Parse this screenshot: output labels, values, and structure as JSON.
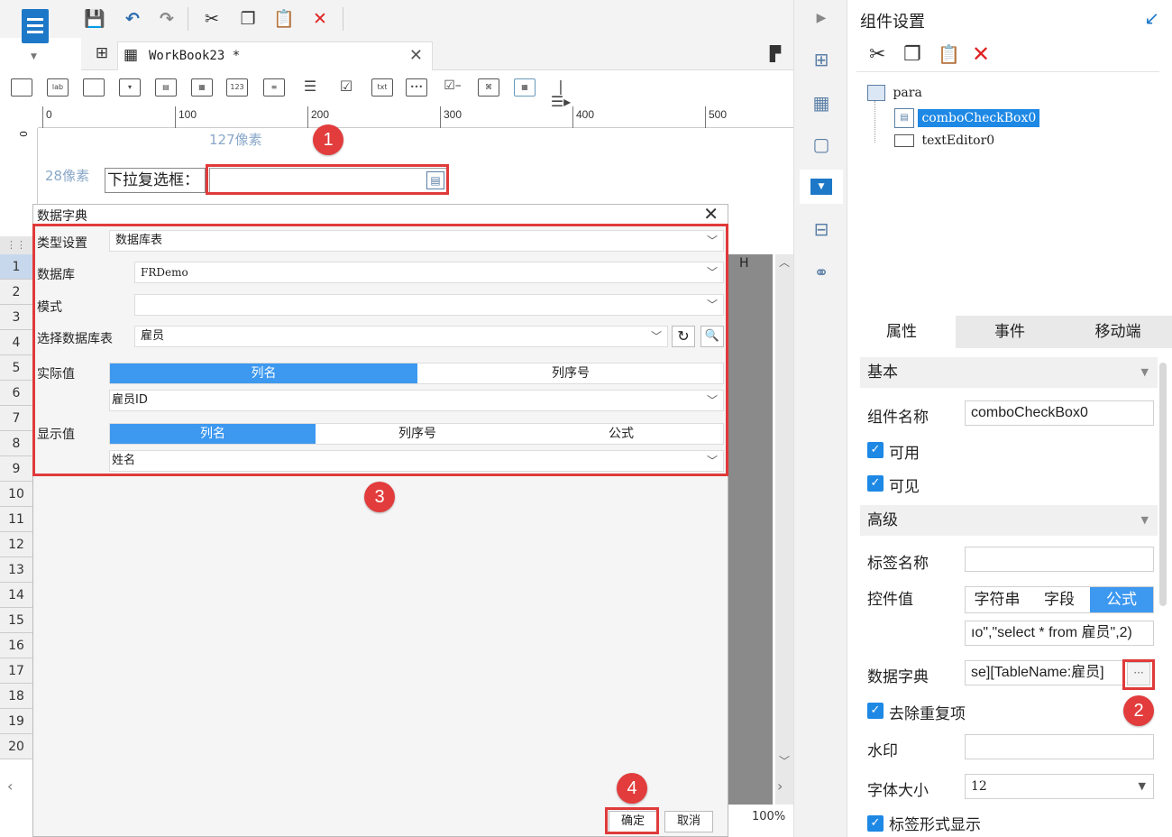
{
  "toolbar": {
    "tab_name": "WorkBook23 *",
    "actions": [
      "save-icon",
      "undo-icon",
      "redo-icon",
      "cut-icon",
      "copy-icon",
      "paste-icon",
      "delete-icon"
    ]
  },
  "widget_toolbar": {
    "icons": [
      "label-widget",
      "text-widget",
      "textarea-widget",
      "dropdown-widget",
      "date-widget",
      "calendar-widget",
      "number-widget",
      "list-widget",
      "radio-group-widget",
      "checkbox-group-widget",
      "text-field-widget",
      "password-widget",
      "checkbox-widget",
      "tree-widget",
      "table-widget",
      "more-widget"
    ],
    "lab_text": "lab",
    "num_text": "123",
    "txt_text": "txt"
  },
  "ruler": {
    "ticks": [
      "0",
      "100",
      "200",
      "300",
      "400",
      "500"
    ],
    "v_tick": "0"
  },
  "canvas": {
    "width_hint": "127像素",
    "height_hint": "28像素",
    "label": "下拉复选框："
  },
  "sheet": {
    "rows": [
      "1",
      "2",
      "3",
      "4",
      "5",
      "6",
      "7",
      "8",
      "9",
      "10",
      "11",
      "12",
      "13",
      "14",
      "15",
      "16",
      "17",
      "18",
      "19",
      "20"
    ],
    "col_h": "H",
    "zoom": "100%"
  },
  "dialog": {
    "title": "数据字典",
    "type_label": "类型设置",
    "type_value": "数据库表",
    "db_label": "数据库",
    "db_value": "FRDemo",
    "schema_label": "模式",
    "schema_value": "",
    "table_label": "选择数据库表",
    "table_value": "雇员",
    "actual_label": "实际值",
    "actual_tabs": [
      "列名",
      "列序号"
    ],
    "actual_value": "雇员ID",
    "display_label": "显示值",
    "display_tabs": [
      "列名",
      "列序号",
      "公式"
    ],
    "display_value": "姓名",
    "ok": "确定",
    "cancel": "取消"
  },
  "right_panel": {
    "title": "组件设置",
    "tree": [
      "para",
      "comboCheckBox0",
      "textEditor0"
    ],
    "tabs": [
      "属性",
      "事件",
      "移动端"
    ],
    "basic": "基本",
    "name_label": "组件名称",
    "name_value": "comboCheckBox0",
    "enabled": "可用",
    "visible": "可见",
    "advanced": "高级",
    "tag_label": "标签名称",
    "tag_value": "",
    "ctrl_label": "控件值",
    "ctrl_tabs": [
      "字符串",
      "字段",
      "公式"
    ],
    "ctrl_formula": "ıo\",\"select * from 雇员\",2)",
    "dict_label": "数据字典",
    "dict_value": "se][TableName:雇员]",
    "dict_btn": "···",
    "dedupe": "去除重复项",
    "watermark_label": "水印",
    "watermark_value": "",
    "fontsize_label": "字体大小",
    "fontsize_value": "12",
    "label_style": "标签形式显示"
  },
  "markers": [
    "1",
    "2",
    "3",
    "4"
  ],
  "colors": {
    "accent": "#3d98f0",
    "highlight": "#e03a3a",
    "brand": "#1e78c8"
  }
}
